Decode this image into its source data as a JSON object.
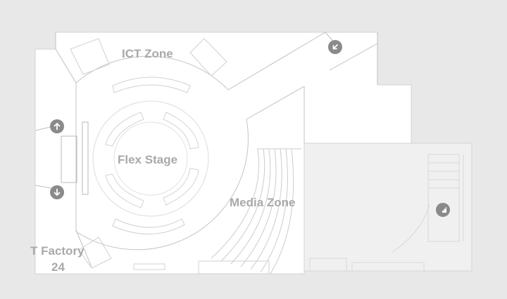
{
  "colors": {
    "background": "#e8e8e8",
    "room_fill": "#ffffff",
    "annex_fill": "#f0f0f0",
    "wall_stroke": "#c8c8c8",
    "label": "#a9a9a9",
    "icon_badge": "#8a8a8a",
    "icon_glyph": "#ffffff"
  },
  "zones": {
    "ict": "ICT Zone",
    "flex": "Flex Stage",
    "media": "Media Zone",
    "tfactory_name": "T Factory",
    "tfactory_number": "24"
  },
  "map_icons": [
    {
      "name": "exit-arrow-icon",
      "direction": "down-left"
    },
    {
      "name": "stairs-up-arrow-icon",
      "direction": "up"
    },
    {
      "name": "stairs-down-arrow-icon",
      "direction": "down"
    },
    {
      "name": "escalator-icon",
      "direction": "up-right"
    }
  ]
}
